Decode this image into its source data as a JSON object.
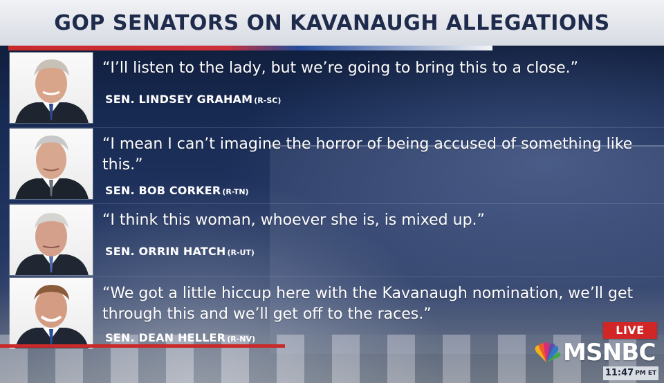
{
  "header": {
    "title": "GOP SENATORS ON KAVANAUGH ALLEGATIONS"
  },
  "quotes": [
    {
      "text": "“I’ll listen to the lady, but we’re going to bring this to a close.”",
      "name": "SEN. LINDSEY GRAHAM",
      "party": "(R-SC)"
    },
    {
      "text": "“I mean I can’t imagine the horror of being accused of something like this.”",
      "name": "SEN. BOB CORKER",
      "party": "(R-TN)"
    },
    {
      "text": "“I think this woman, whoever she is, is mixed up.”",
      "name": "SEN. ORRIN HATCH",
      "party": "(R-UT)"
    },
    {
      "text": "“We got a little hiccup here with the Kavanaugh nomination, we’ll get through this and we’ll get off to the races.”",
      "name": "SEN. DEAN HELLER",
      "party": "(R-NV)"
    }
  ],
  "live_badge": "LIVE",
  "logo": {
    "brand": "MSNBC",
    "icon": "peacock-icon"
  },
  "time": {
    "clock": "11:47",
    "suffix": "PM ET"
  },
  "colors": {
    "title_text": "#1f2b4c",
    "red": "#d22525",
    "blue": "#234a9a"
  }
}
